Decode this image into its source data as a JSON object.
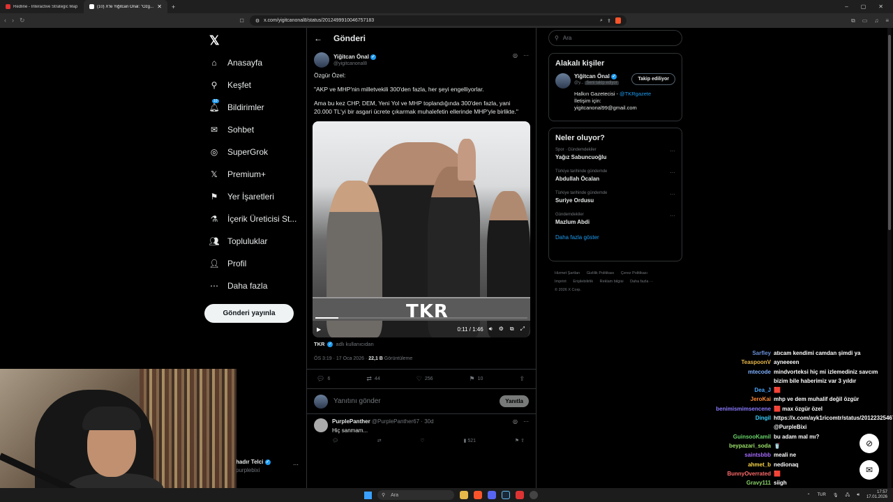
{
  "browser": {
    "tabs": [
      {
        "title": "Redline - Interactive Strategic Map",
        "active": false
      },
      {
        "title": "(10) X'te Yiğitcan Önal: \"Özg...",
        "active": true
      }
    ],
    "url": "x.com/yigitcanonal8/status/2012499910046757183"
  },
  "nav": {
    "items": [
      {
        "label": "Anasayfa",
        "icon": "home-icon"
      },
      {
        "label": "Keşfet",
        "icon": "search-icon"
      },
      {
        "label": "Bildirimler",
        "icon": "bell-icon",
        "badge": "10"
      },
      {
        "label": "Sohbet",
        "icon": "mail-icon"
      },
      {
        "label": "SuperGrok",
        "icon": "grok-icon"
      },
      {
        "label": "Premium+",
        "icon": "x-icon"
      },
      {
        "label": "Yer İşaretleri",
        "icon": "bookmark-icon"
      },
      {
        "label": "İçerik Üreticisi St...",
        "icon": "flask-icon"
      },
      {
        "label": "Topluluklar",
        "icon": "people-icon"
      },
      {
        "label": "Profil",
        "icon": "person-icon"
      },
      {
        "label": "Daha fazla",
        "icon": "more-circle-icon"
      }
    ],
    "post_button": "Gönderi yayınla",
    "account_name": "hadır Telci",
    "account_handle": "purplebixi"
  },
  "post": {
    "header": "Gönderi",
    "author_name": "Yiğitcan Önal",
    "author_handle": "@yigitcanonal8",
    "paragraphs": [
      "Özgür Özel:",
      "\"AKP ve MHP'nin milletvekili 300'den fazla, her şeyi engelliyorlar.",
      "Ama bu kez CHP, DEM, Yeni Yol ve MHP toplandığında 300'den fazla, yani 20.000 TL'yi bir asgari ücrete çıkarmak muhalefetin ellerinde MHP'yle birlikte.\""
    ],
    "video": {
      "watermark": "TKR",
      "time": "0:11 / 1:46",
      "progress": 0.11
    },
    "source_user": "TKR",
    "source_text": "adlı kullanıcıdan",
    "timestamp": "ÖS 3:19 · 17 Oca 2026 ·",
    "views": "22,1 B",
    "views_label": "Görüntüleme",
    "stats": {
      "replies": "6",
      "reposts": "44",
      "likes": "256",
      "bookmarks": "10"
    },
    "reply_placeholder": "Yanıtını gönder",
    "reply_button": "Yanıtla"
  },
  "comment": {
    "name": "PurplePanther",
    "handle": "@PurplePanther67 · 30d",
    "text": "Hiç sanmam...",
    "views": "521"
  },
  "sidebar": {
    "search_placeholder": "Ara",
    "related_title": "Alakalı kişiler",
    "related_name": "Yiğitcan Önal",
    "related_handle": "@y...",
    "follows_you": "Seni takip ediyor",
    "follow_button": "Takip ediliyor",
    "bio_line1": "Halkın Gazetecisi - ",
    "bio_link": "@TKRgazete",
    "bio_line2": "İletişim için:",
    "bio_line3": "yigitcanonal99@gmail.com",
    "trends_title": "Neler oluyor?",
    "trends": [
      {
        "context": "Spor · Gündemdekiler",
        "title": "Yağız Sabuncuoğlu"
      },
      {
        "context": "Türkiye tarihinde gündemde",
        "title": "Abdullah Öcalan"
      },
      {
        "context": "Türkiye tarihinde gündemde",
        "title": "Suriye Ordusu"
      },
      {
        "context": "Gündemdekiler",
        "title": "Mazlum Abdi"
      }
    ],
    "show_more": "Daha fazla göster",
    "footer": [
      "Hizmet Şartları",
      "Gizlilik Politikası",
      "Çerez Politikası",
      "Imprint",
      "Erişilebilirlik",
      "Reklam bilgisi",
      "Daha fazla ···",
      "© 2026 X Corp."
    ]
  },
  "chat": [
    {
      "user": "Sarfley",
      "color": "#6a8fd8",
      "text": "atıcam kendimi camdan şimdi ya"
    },
    {
      "user": "TeaspoonV",
      "color": "#e8b84a",
      "text": "ayneeeen"
    },
    {
      "user": "mtecode",
      "color": "#7fb0ff",
      "text": "mindvorteksi hiç mi izlemediniz savcım bizim bile haberimiz var 3 yıldır"
    },
    {
      "user": "Dea_J",
      "color": "#4aa8ff",
      "text": "🟥"
    },
    {
      "user": "JeroKai",
      "color": "#ff8c3a",
      "text": "mhp ve dem muhalif değil özgür"
    },
    {
      "user": "benimismimsencene",
      "color": "#8a7bff",
      "text": "🟥 max özgür özel"
    },
    {
      "user": "Dingil",
      "color": "#3ad0ff",
      "text": "https://x.com/ayk1ricomtr/status/2012232546700890494 @PurpleBixi"
    },
    {
      "user": "GuinsooKamil",
      "color": "#6ad46a",
      "text": "bu adam mal mı?"
    },
    {
      "user": "beypazari_soda",
      "color": "#9be36a",
      "text": "🥤"
    },
    {
      "user": "saintsbbb",
      "color": "#a56bff",
      "text": "meali ne"
    },
    {
      "user": "ahmet_b",
      "color": "#ffd84a",
      "text": "nedionaq"
    },
    {
      "user": "BunnyOverrated",
      "color": "#ff6a6a",
      "text": "🟥"
    },
    {
      "user": "Gravy111",
      "color": "#8ad46a",
      "text": "siigh"
    }
  ],
  "taskbar": {
    "search": "Ara",
    "lang": "TUR",
    "time": "17:57",
    "date": "17.01.2026"
  }
}
